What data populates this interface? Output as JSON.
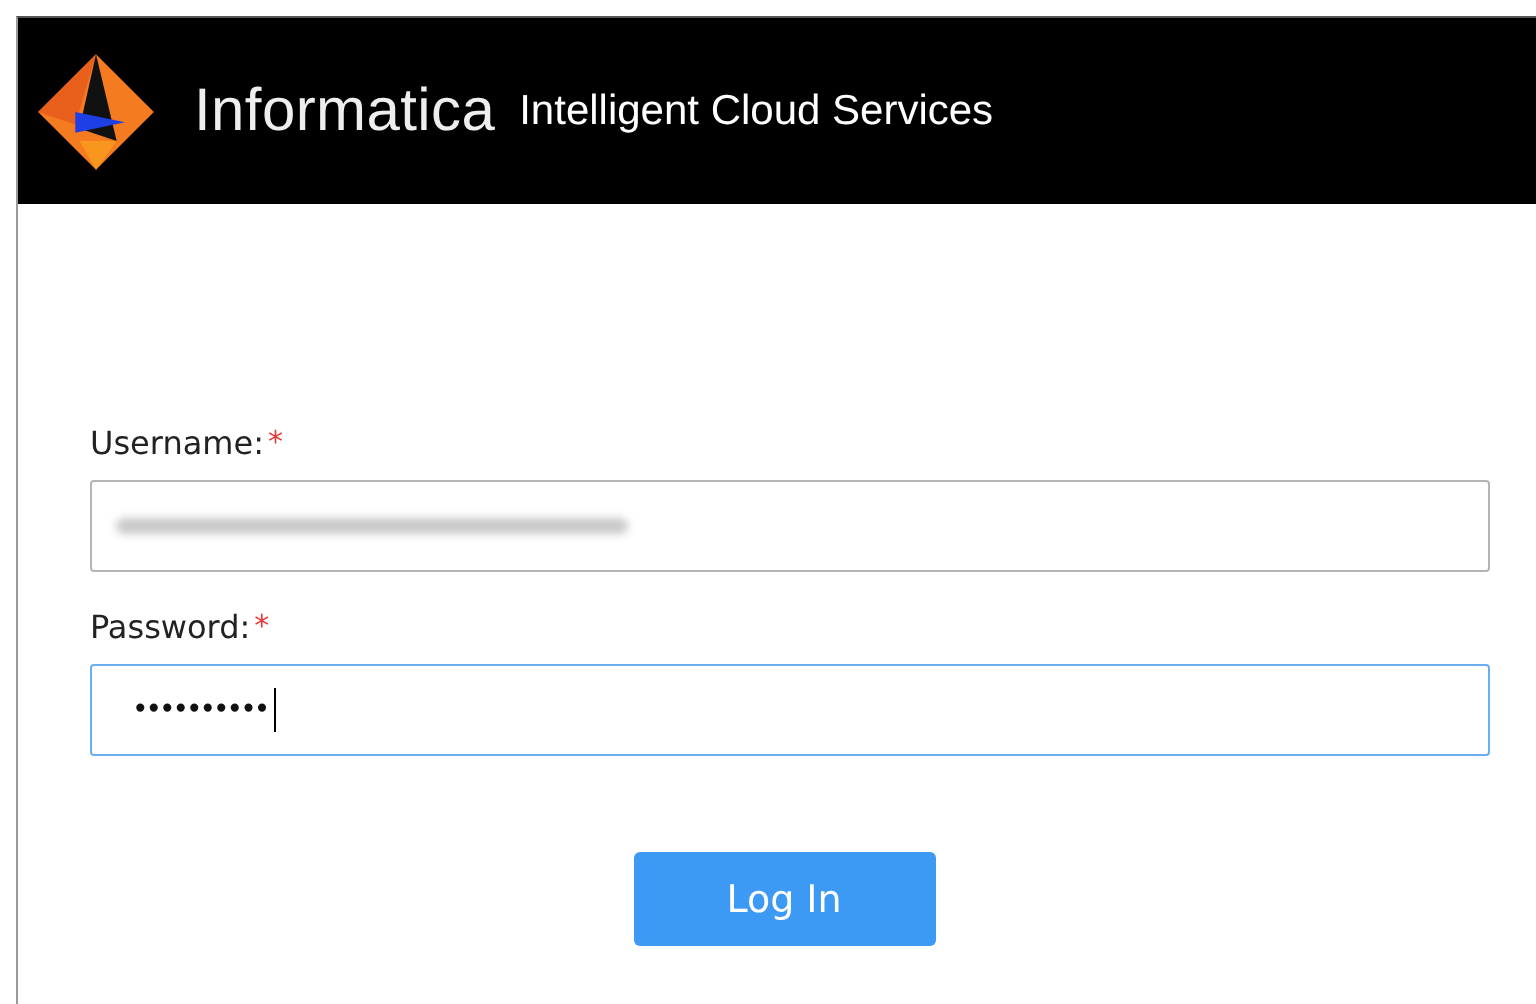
{
  "header": {
    "brand": "Informatica",
    "product": "Intelligent Cloud Services"
  },
  "form": {
    "fields": [
      {
        "label": "Username:",
        "required_mark": "*",
        "redacted": true,
        "focused": false
      },
      {
        "label": "Password:",
        "required_mark": "*",
        "value": "••••••••••",
        "focused": true
      }
    ],
    "button": "Log In"
  }
}
